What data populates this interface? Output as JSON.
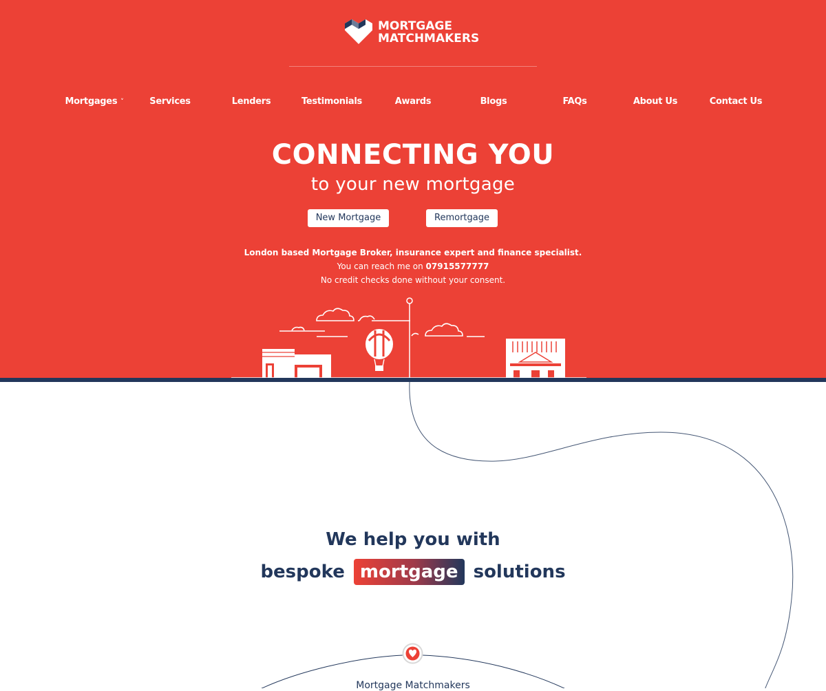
{
  "logo": {
    "line1": "MORTGAGE",
    "line2": "MATCHMAKERS",
    "icon": "heart-house-logo-icon"
  },
  "nav": {
    "items": [
      {
        "label": "Mortgages",
        "has_dropdown": true
      },
      {
        "label": "Services"
      },
      {
        "label": "Lenders"
      },
      {
        "label": "Testimonials"
      },
      {
        "label": "Awards"
      },
      {
        "label": "Blogs"
      },
      {
        "label": "FAQs"
      },
      {
        "label": "About Us"
      },
      {
        "label": "Contact Us"
      }
    ],
    "dropdown_icon": "chevron-down-icon"
  },
  "hero": {
    "title": "CONNECTING YOU",
    "subtitle": "to your new mortgage",
    "cta_new": "New Mortgage",
    "cta_remortgage": "Remortgage",
    "intro_line1": "London based Mortgage Broker, insurance expert and finance specialist.",
    "intro_line2_prefix": "You can reach me on ",
    "intro_phone": "07915577777",
    "intro_line3": "No credit checks done without your consent."
  },
  "section": {
    "headline_line1": "We help you with",
    "headline_pre": "bespoke",
    "headline_highlight": "mortgage",
    "headline_post": "solutions",
    "bottom_label": "Mortgage Matchmakers"
  },
  "colors": {
    "brand_red": "#ec4136",
    "navy": "#22375b",
    "white": "#ffffff"
  }
}
